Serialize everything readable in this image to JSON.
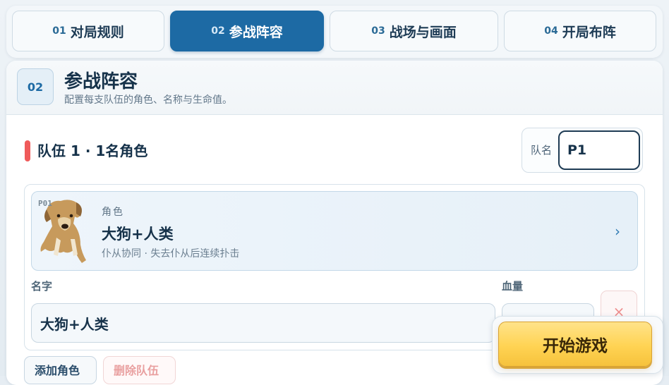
{
  "steps": [
    {
      "num": "01",
      "label": "对局规则"
    },
    {
      "num": "02",
      "label": "参战阵容"
    },
    {
      "num": "03",
      "label": "战场与画面"
    },
    {
      "num": "04",
      "label": "开局布阵"
    }
  ],
  "section": {
    "badge": "02",
    "title": "参战阵容",
    "subtitle": "配置每支队伍的角色、名称与生命值。"
  },
  "team": {
    "title": "队伍 1 · 1名角色",
    "name_label": "队名",
    "name_value": "P1",
    "bar_color": "#ef5a5a"
  },
  "character": {
    "tag": "P01",
    "role_label": "角色",
    "role_name": "大狗+人类",
    "role_desc": "仆从协同 · 失去仆从后连续扑击",
    "image": "dog-portrait",
    "chevron": "chevron-right-icon"
  },
  "fields": {
    "name_label": "名字",
    "name_value": "大狗+人类",
    "hp_label": "血量",
    "hp_value": ""
  },
  "buttons": {
    "remove_icon": "×",
    "add_role": "添加角色",
    "delete_team": "删除队伍",
    "start": "开始游戏"
  },
  "colors": {
    "accent": "#1d6aa4",
    "start": "#ffd353",
    "danger": "#ef5a5a"
  }
}
